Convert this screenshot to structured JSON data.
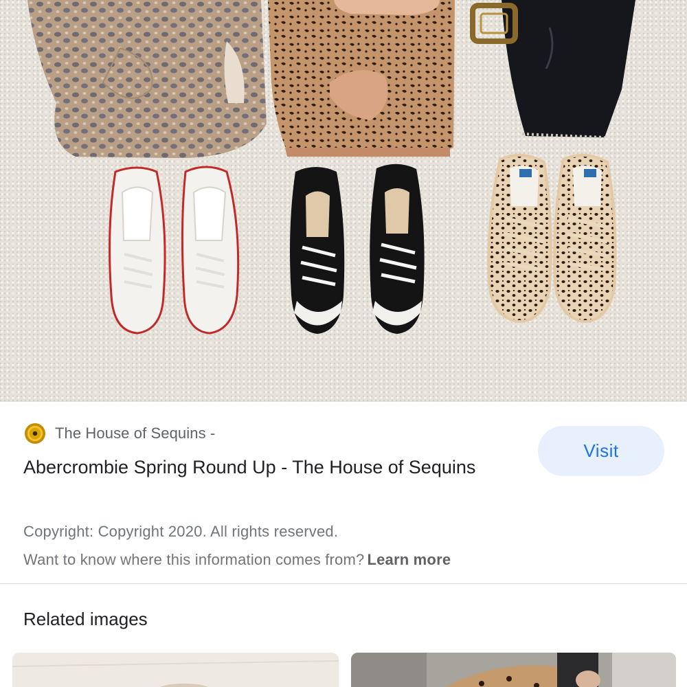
{
  "hero_image": {
    "alt_icon": "outfit-flatlay-photo"
  },
  "source": {
    "favicon": "sequin-favicon-icon",
    "name": "The House of Sequins -"
  },
  "result": {
    "title": "Abercrombie Spring Round Up - The House of Sequins",
    "visit_label": "Visit",
    "copyright": "Copyright: Copyright 2020. All rights reserved.",
    "info_prompt": "Want to know where this information comes from?",
    "learn_more": "Learn more"
  },
  "related": {
    "heading": "Related images",
    "thumbnails": [
      {
        "name": "related-image-1"
      },
      {
        "name": "related-image-2"
      }
    ]
  },
  "colors": {
    "accent": "#1a73e8",
    "button_bg": "#e8f0fe",
    "secondary_text": "#70757a"
  }
}
